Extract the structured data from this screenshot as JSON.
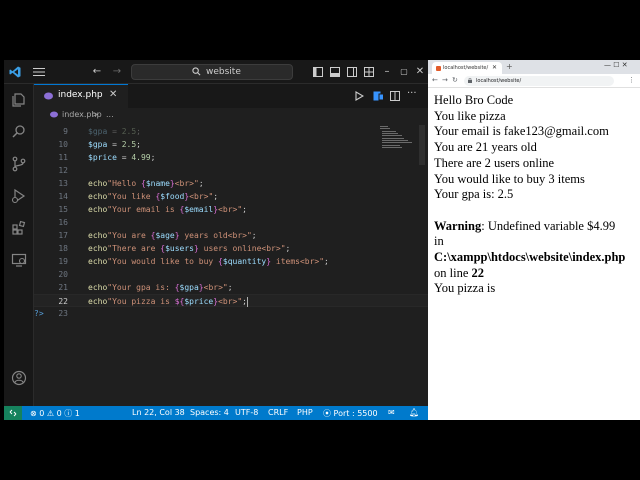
{
  "vscode": {
    "search_text": "website",
    "tab_label": "index.php",
    "tab_close": "✕",
    "breadcrumb": {
      "file": "index.php",
      "sep": ">",
      "rest": "..."
    },
    "status": {
      "errors": "0",
      "warnings": "0",
      "info": "1",
      "position": "Ln 22, Col 38",
      "spaces": "Spaces: 4",
      "encoding": "UTF-8",
      "eol": "CRLF",
      "language": "PHP",
      "port": "Port : 5500"
    },
    "code": [
      {
        "n": "9",
        "t": "$gpa = 2.5;"
      },
      {
        "n": "10",
        "t": "$gpa = 2.5;"
      },
      {
        "n": "11",
        "t": "$price = 4.99;"
      },
      {
        "n": "12",
        "t": ""
      },
      {
        "n": "13",
        "t": "echo\"Hello {$name}<br>\";"
      },
      {
        "n": "14",
        "t": "echo\"You like {$food}<br>\";"
      },
      {
        "n": "15",
        "t": "echo\"Your email is {$email}<br>\";"
      },
      {
        "n": "16",
        "t": ""
      },
      {
        "n": "17",
        "t": "echo\"You are {$age} years old<br>\";"
      },
      {
        "n": "18",
        "t": "echo\"There are {$users} users online<br>\";"
      },
      {
        "n": "19",
        "t": "echo\"You would like to buy {$quantity} items<br>\";"
      },
      {
        "n": "20",
        "t": ""
      },
      {
        "n": "21",
        "t": "echo\"Your gpa is: {$gpa}<br>\";"
      },
      {
        "n": "22",
        "t": "echo\"You pizza is ${$price}<br>\";"
      },
      {
        "n": "23",
        "t": "?>"
      }
    ]
  },
  "browser": {
    "tab_title": "localhost/website/",
    "new_tab": "+",
    "url": "localhost/website/",
    "window_controls": "—  ☐  ✕",
    "output": {
      "line1": "Hello Bro Code",
      "line2": "You like pizza",
      "line3": "Your email is fake123@gmail.com",
      "line4": "You are 21 years old",
      "line5": "There are 2 users online",
      "line6": "You would like to buy 3 items",
      "line7": "Your gpa is: 2.5",
      "warning_label": "Warning",
      "warning_text": ": Undefined variable $4.99",
      "in_text": "in",
      "path": "C:\\xampp\\htdocs\\website\\index.php",
      "on_line_text": "on line ",
      "line_number": "22",
      "last_line": "You pizza is"
    }
  },
  "colors": {
    "vscode_bg": "#1f1f1f",
    "statusbar": "#007acc",
    "keyword": "#dcdcaa",
    "string": "#ce9178",
    "variable": "#9cdcfe"
  }
}
